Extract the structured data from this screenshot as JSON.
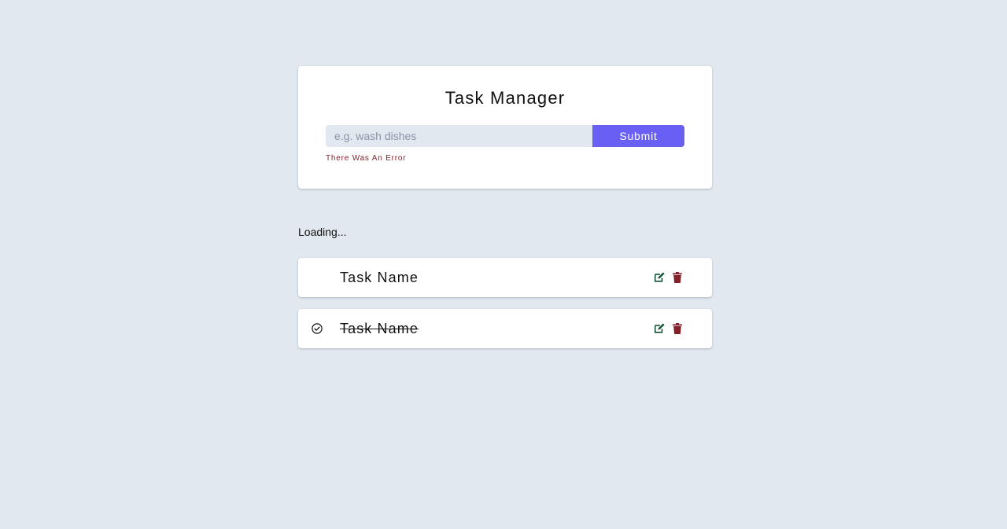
{
  "form": {
    "title": "Task Manager",
    "input_placeholder": "e.g. wash dishes",
    "input_value": "",
    "submit_label": "Submit",
    "alert_text": "There Was An Error"
  },
  "loading_text": "Loading...",
  "tasks": [
    {
      "name": "Task Name",
      "completed": false,
      "edit_icon": "edit-icon",
      "delete_icon": "trash-icon"
    },
    {
      "name": "Task Name",
      "completed": true,
      "status_icon": "check-circle-icon",
      "edit_icon": "edit-icon",
      "delete_icon": "trash-icon"
    }
  ],
  "colors": {
    "background": "#e2e8f0",
    "primary": "#6a5ff4",
    "alert": "#842029",
    "edit": "#0f5132",
    "delete": "#842029"
  }
}
